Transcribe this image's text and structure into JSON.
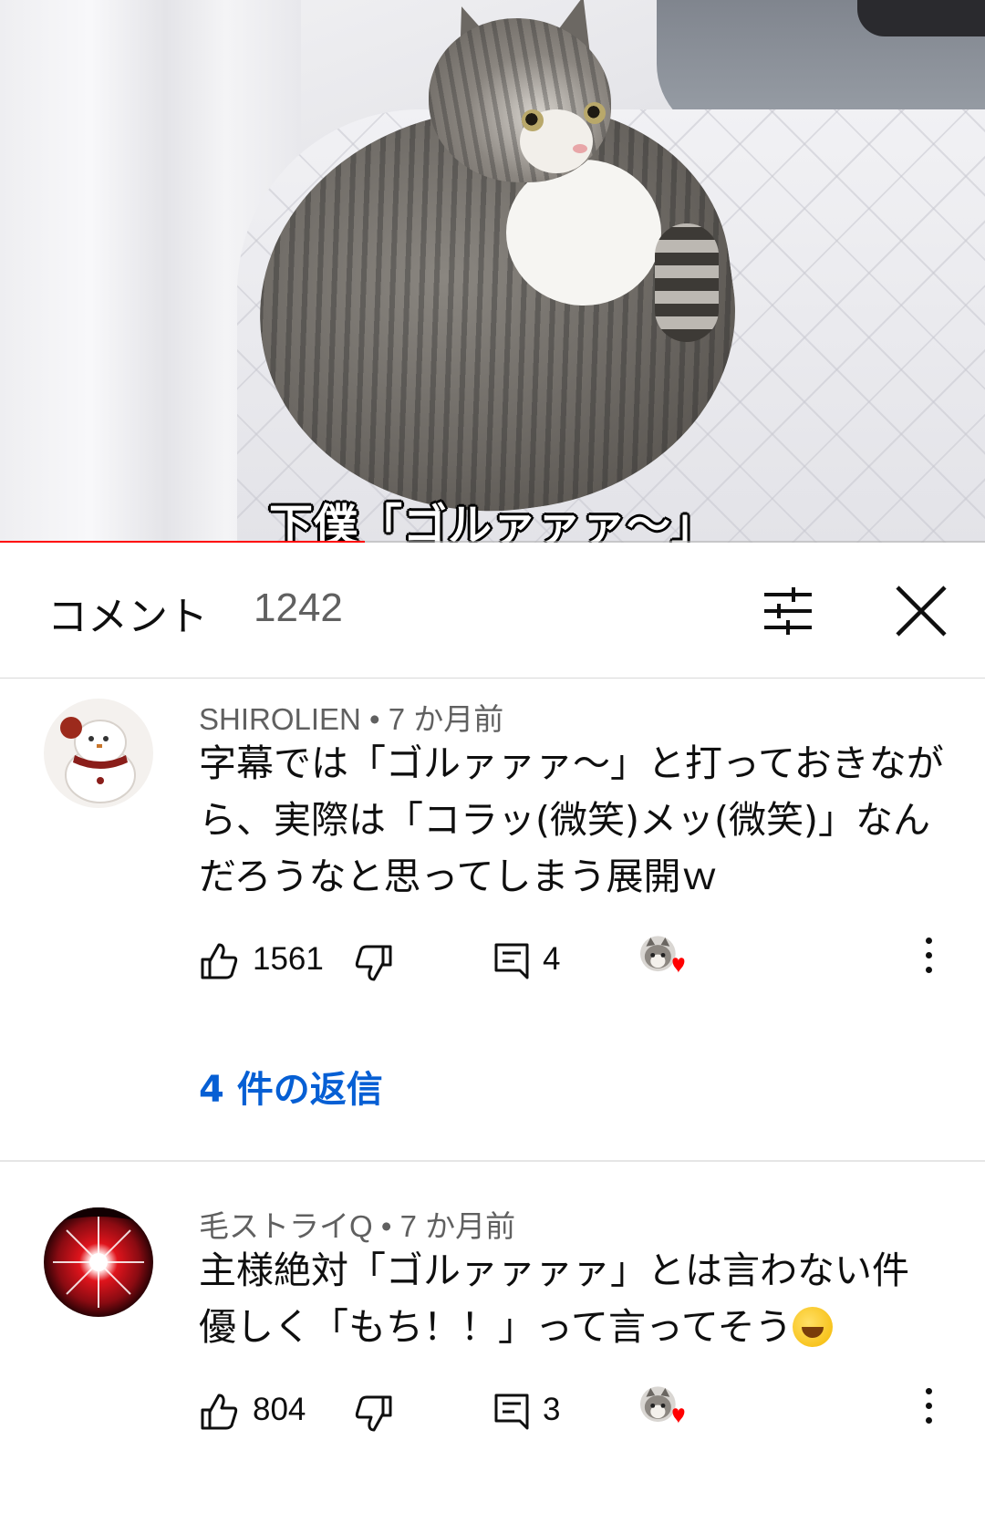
{
  "video": {
    "subtitle": "下僕「ゴルァァァ〜」",
    "progress": 0.37
  },
  "comments_header": {
    "title": "コメント",
    "count": "1242"
  },
  "comments": [
    {
      "author": "SHIROLIEN",
      "time": "7 か月前",
      "text": "字幕では「ゴルァァァ〜」と打っておきながら、実際は「コラッ(微笑)メッ(微笑)」なんだろうなと思ってしまう展開ｗ",
      "likes": "1561",
      "replies_count": "4",
      "replies_link": "4 件の返信"
    },
    {
      "author": "毛ストライQ",
      "time": "7 か月前",
      "text_line1": "主様絶対「ゴルァァァァ」とは言わない件",
      "text_line2": "優しく「もち！！」って言ってそう",
      "likes": "804",
      "replies_count": "3"
    }
  ],
  "colors": {
    "accent": "#ff0000",
    "link": "#065fd4",
    "secondary_text": "#606060"
  },
  "icons": [
    "filter-icon",
    "close-icon",
    "like-icon",
    "dislike-icon",
    "reply-icon",
    "creator-heart-icon",
    "more-icon",
    "laughing-emoji-icon"
  ]
}
